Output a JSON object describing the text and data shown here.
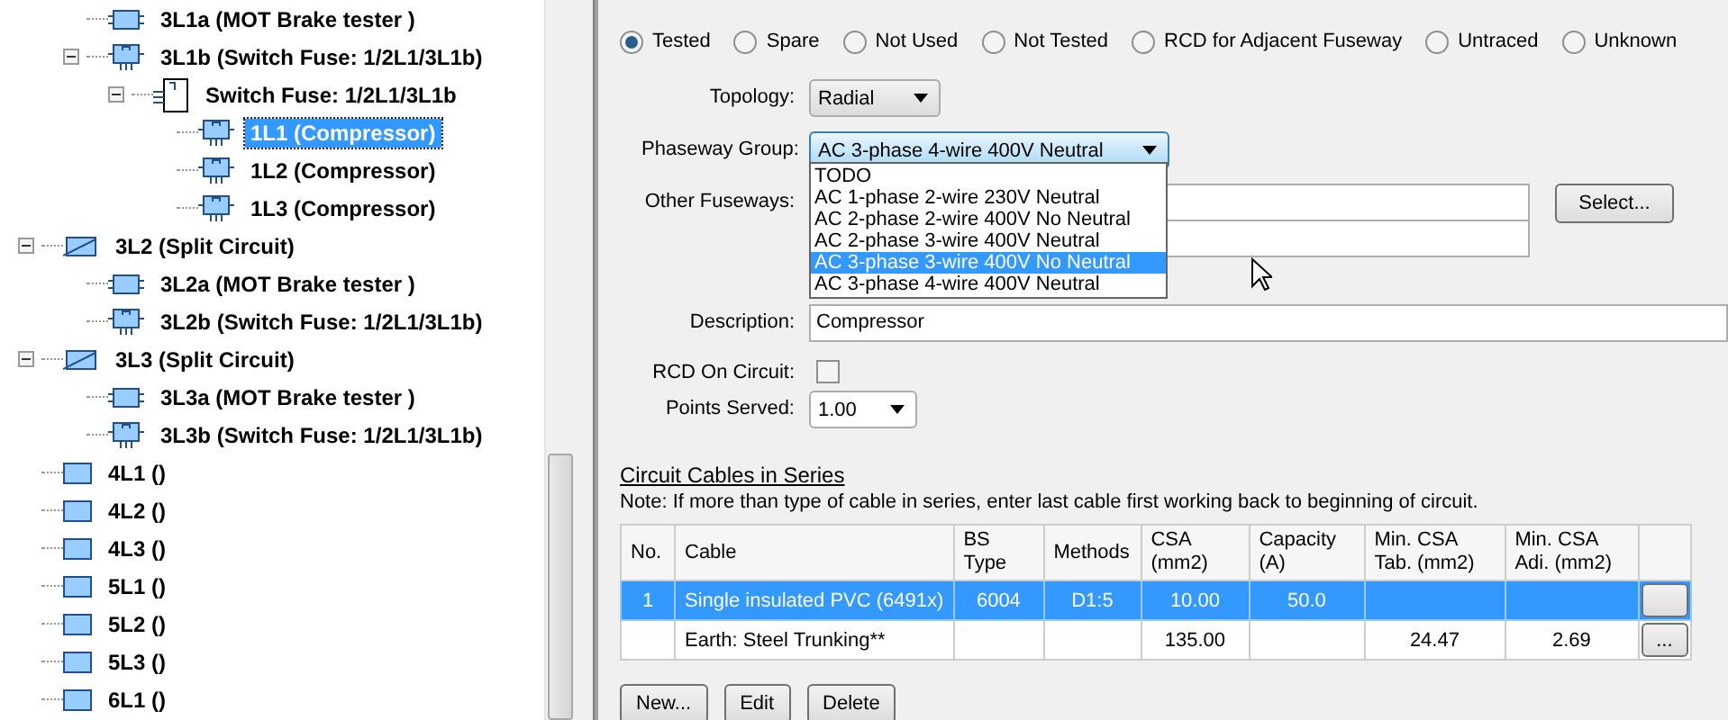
{
  "tree": {
    "continued_children": [
      {
        "label": "3L1a (MOT Brake tester )",
        "kind": "circuit",
        "selected": false
      },
      {
        "label": "3L1b (Switch Fuse: 1/2L1/3L1b)",
        "kind": "fused_circuit",
        "selected": false,
        "expanded": true,
        "children": [
          {
            "label": "Switch Fuse: 1/2L1/3L1b",
            "kind": "switch_fuse",
            "selected": false,
            "expanded": true,
            "children": [
              {
                "label": "1L1 (Compressor)",
                "kind": "fused_circuit",
                "selected": true
              },
              {
                "label": "1L2 (Compressor)",
                "kind": "fused_circuit",
                "selected": false
              },
              {
                "label": "1L3 (Compressor)",
                "kind": "fused_circuit",
                "selected": false
              }
            ]
          }
        ]
      }
    ],
    "items": [
      {
        "label": "3L2 (Split Circuit)",
        "kind": "split",
        "selected": false,
        "expanded": true,
        "children": [
          {
            "label": "3L2a (MOT Brake tester )",
            "kind": "circuit",
            "selected": false
          },
          {
            "label": "3L2b (Switch Fuse: 1/2L1/3L1b)",
            "kind": "fused_circuit",
            "selected": false
          }
        ]
      },
      {
        "label": "3L3 (Split Circuit)",
        "kind": "split",
        "selected": false,
        "expanded": true,
        "children": [
          {
            "label": "3L3a (MOT Brake tester )",
            "kind": "circuit",
            "selected": false
          },
          {
            "label": "3L3b (Switch Fuse: 1/2L1/3L1b)",
            "kind": "fused_circuit",
            "selected": false
          }
        ]
      },
      {
        "label": "4L1 ()",
        "kind": "way",
        "selected": false
      },
      {
        "label": "4L2 ()",
        "kind": "way",
        "selected": false
      },
      {
        "label": "4L3 ()",
        "kind": "way",
        "selected": false
      },
      {
        "label": "5L1 ()",
        "kind": "way",
        "selected": false
      },
      {
        "label": "5L2 ()",
        "kind": "way",
        "selected": false
      },
      {
        "label": "5L3 ()",
        "kind": "way",
        "selected": false
      },
      {
        "label": "6L1 ()",
        "kind": "way",
        "selected": false
      }
    ]
  },
  "status_options": [
    {
      "label": "Tested",
      "selected": true
    },
    {
      "label": "Spare",
      "selected": false
    },
    {
      "label": "Not Used",
      "selected": false
    },
    {
      "label": "Not Tested",
      "selected": false
    },
    {
      "label": "RCD for Adjacent Fuseway",
      "selected": false
    },
    {
      "label": "Untraced",
      "selected": false
    },
    {
      "label": "Unknown",
      "selected": false
    }
  ],
  "topology": {
    "label": "Topology:",
    "value": "Radial"
  },
  "phaseway_group": {
    "label": "Phaseway Group:",
    "value": "AC 3-phase 4-wire 400V Neutral",
    "expanded": true,
    "options": [
      {
        "label": "TODO",
        "highlighted": false
      },
      {
        "label": "AC 1-phase 2-wire 230V Neutral",
        "highlighted": false
      },
      {
        "label": "AC 2-phase 2-wire 400V No Neutral",
        "highlighted": false
      },
      {
        "label": "AC 2-phase 3-wire 400V Neutral",
        "highlighted": false
      },
      {
        "label": "AC 3-phase 3-wire 400V No Neutral",
        "highlighted": true
      },
      {
        "label": "AC 3-phase 4-wire 400V Neutral",
        "highlighted": false
      }
    ]
  },
  "other_fuseways": {
    "label": "Other Fuseways:",
    "button": "Select..."
  },
  "description": {
    "label": "Description:",
    "value": "Compressor"
  },
  "rcd_on_circuit": {
    "label": "RCD On Circuit:",
    "checked": false
  },
  "points_served": {
    "label": "Points Served:",
    "value": "1.00"
  },
  "cables": {
    "title": "Circuit Cables in Series",
    "note": "Note: If more than type of cable in series, enter last cable first working back to beginning of circuit.",
    "columns": [
      "No.",
      "Cable",
      "BS Type",
      "Methods",
      "CSA (mm2)",
      "Capacity (A)",
      "Min. CSA Tab. (mm2)",
      "Min. CSA Adi. (mm2)"
    ],
    "rows": [
      {
        "selected": true,
        "cells": [
          "1",
          "Single insulated PVC (6491x)",
          "6004",
          "D1:5",
          "10.00",
          "50.0",
          "",
          ""
        ],
        "button": ""
      },
      {
        "selected": false,
        "cells": [
          "",
          "Earth: Steel Trunking**",
          "",
          "",
          "135.00",
          "",
          "24.47",
          "2.69"
        ],
        "button": "..."
      }
    ],
    "buttons": [
      "New...",
      "Edit",
      "Delete"
    ]
  }
}
